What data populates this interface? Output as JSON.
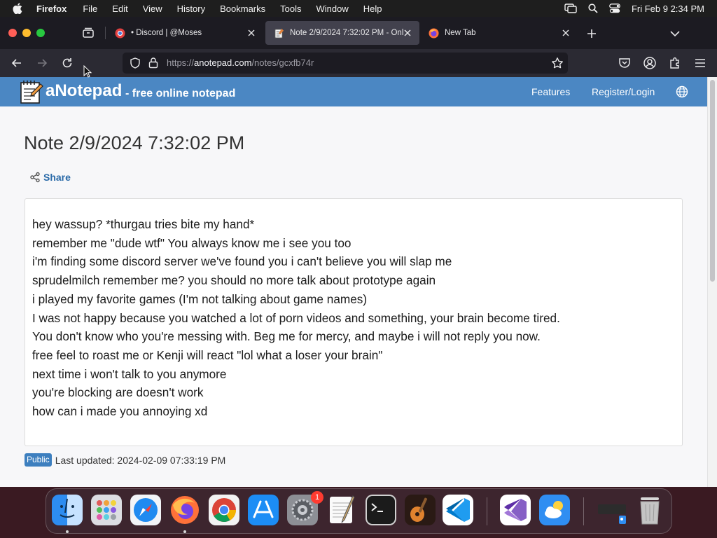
{
  "menubar": {
    "app_name": "Firefox",
    "items": [
      "File",
      "Edit",
      "View",
      "History",
      "Bookmarks",
      "Tools",
      "Window",
      "Help"
    ],
    "clock": "Fri Feb 9  2:34 PM"
  },
  "tabs": [
    {
      "title": "• Discord | @Moses",
      "active": false
    },
    {
      "title": "Note 2/9/2024 7:32:02 PM - Onl",
      "active": true
    },
    {
      "title": "New Tab",
      "active": false
    }
  ],
  "urlbar": {
    "scheme": "https://",
    "host": "anotepad.com",
    "path": "/notes/gcxfb74r"
  },
  "site": {
    "name": "aNotepad",
    "tagline": "- free online notepad",
    "nav": [
      "Features",
      "Register/Login"
    ]
  },
  "note": {
    "title": "Note 2/9/2024 7:32:02 PM",
    "share_label": "Share",
    "lines": [
      "hey wassup? *thurgau tries bite my hand*",
      "remember me \"dude wtf\" You always know me i see you too",
      "i'm finding some discord server we've found you i can't believe you will slap me",
      "sprudelmilch remember me? you should no more talk about prototype again",
      "i played my favorite games (I'm not talking about game names)",
      "I was not happy because you watched a lot of porn videos and something, your brain become tired.",
      "You don't know who you're messing with. Beg me for mercy, and maybe i will not reply you now.",
      "free feel to roast me or Kenji will react \"lol what a loser your brain\"",
      "next time i won't talk to you anymore",
      "you're blocking are doesn't work",
      "how can i made you annoying xd"
    ],
    "visibility_badge": "Public",
    "last_updated": "Last updated: 2024-02-09 07:33:19 PM"
  },
  "dock": {
    "apps": [
      "Finder",
      "Launchpad",
      "Safari",
      "Firefox",
      "Google Chrome",
      "App Store",
      "System Settings",
      "TextEdit",
      "Terminal",
      "GarageBand",
      "Visual Studio Code",
      "Visual Studio",
      "Weather",
      "Downloads",
      "Trash"
    ],
    "settings_badge": "1"
  },
  "colors": {
    "site_header": "#4b87c3",
    "link": "#2a6aa8",
    "badge": "#3d7fbf",
    "browser_chrome": "#1c1b22"
  }
}
